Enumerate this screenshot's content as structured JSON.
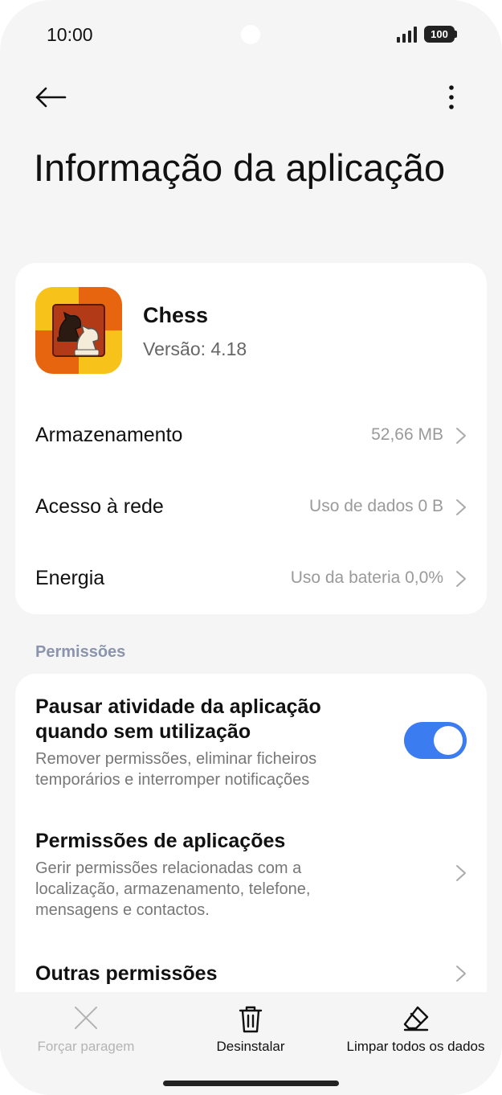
{
  "status_bar": {
    "time": "10:00",
    "battery": "100"
  },
  "header": {
    "back_icon": "arrow-left-icon",
    "more_icon": "more-vertical-icon",
    "title": "Informação da aplicação"
  },
  "app": {
    "name": "Chess",
    "version": "Versão: 4.18",
    "icon": "chess-knight-app-icon"
  },
  "info_rows": [
    {
      "label": "Armazenamento",
      "value": "52,66 MB"
    },
    {
      "label": "Acesso à rede",
      "value": "Uso de dados 0 B"
    },
    {
      "label": "Energia",
      "value": "Uso da bateria 0,0%"
    }
  ],
  "permissions": {
    "section_title": "Permissões",
    "pause": {
      "title": "Pausar atividade da aplicação quando sem utilização",
      "description": "Remover permissões, eliminar ficheiros temporários e interromper notificações",
      "enabled": true
    },
    "app_permissions": {
      "title": "Permissões de aplicações",
      "description": "Gerir permissões relacionadas com a localização, armazenamento, telefone, mensagens e contactos."
    },
    "other": {
      "title": "Outras permissões"
    }
  },
  "actions": {
    "force_stop": {
      "label": "Forçar paragem",
      "icon": "close-icon",
      "enabled": false
    },
    "uninstall": {
      "label": "Desinstalar",
      "icon": "trash-icon"
    },
    "clear_data": {
      "label": "Limpar todos os dados",
      "icon": "eraser-icon"
    }
  },
  "colors": {
    "accent": "#3b7cf0",
    "section_header": "#8a94ad",
    "background": "#f5f5f5"
  }
}
